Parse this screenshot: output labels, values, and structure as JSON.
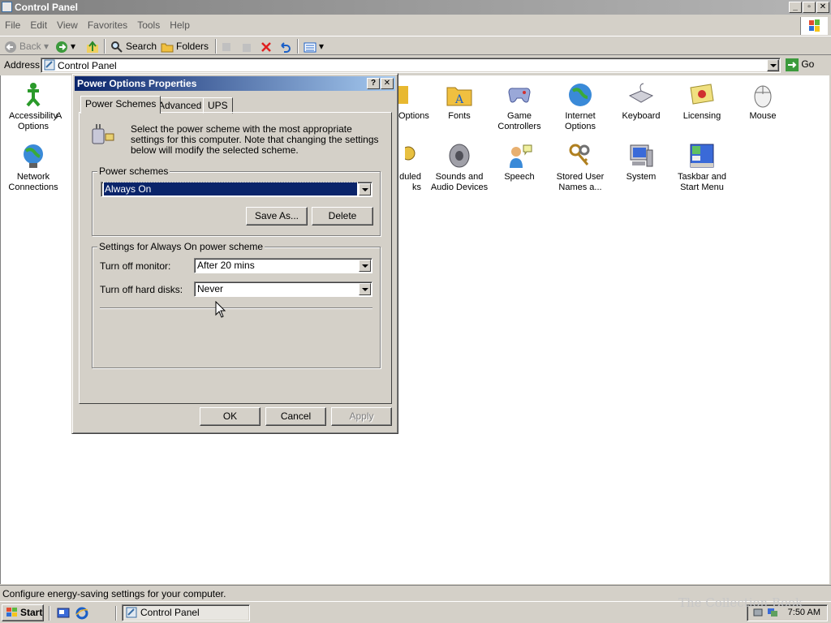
{
  "window": {
    "title": "Control Panel",
    "caption_buttons": [
      "_",
      "▫",
      "✕"
    ]
  },
  "menubar": {
    "items": [
      "File",
      "Edit",
      "View",
      "Favorites",
      "Tools",
      "Help"
    ]
  },
  "toolbar": {
    "back": "Back",
    "search": "Search",
    "folders": "Folders"
  },
  "address": {
    "label": "Address",
    "value": "Control Panel",
    "go": "Go"
  },
  "control_panel_items": [
    {
      "label": "Accessibility Options",
      "icon": "accessibility-icon"
    },
    {
      "label": "A",
      "icon": "add-hardware-icon"
    },
    {
      "label": "Options",
      "icon": "options-icon"
    },
    {
      "label": "Fonts",
      "icon": "fonts-folder-icon"
    },
    {
      "label": "Game Controllers",
      "icon": "game-controller-icon"
    },
    {
      "label": "Internet Options",
      "icon": "internet-globe-icon"
    },
    {
      "label": "Keyboard",
      "icon": "keyboard-icon"
    },
    {
      "label": "Licensing",
      "icon": "licensing-certificate-icon"
    },
    {
      "label": "Mouse",
      "icon": "mouse-icon"
    },
    {
      "label": "Network Connections",
      "icon": "network-globe-icon"
    },
    {
      "label": "duled\nks",
      "icon": "scheduled-tasks-icon"
    },
    {
      "label": "Sounds and Audio Devices",
      "icon": "speaker-icon"
    },
    {
      "label": "Speech",
      "icon": "speech-icon"
    },
    {
      "label": "Stored User Names a...",
      "icon": "keys-icon"
    },
    {
      "label": "System",
      "icon": "system-computer-icon"
    },
    {
      "label": "Taskbar and Start Menu",
      "icon": "taskbar-icon"
    }
  ],
  "dialog": {
    "title": "Power Options Properties",
    "help_btn": "?",
    "close_btn": "✕",
    "tabs": [
      "Power Schemes",
      "Advanced",
      "UPS"
    ],
    "description": "Select the power scheme with the most appropriate settings for this computer. Note that changing the settings below will modify the selected scheme.",
    "schemes_group": "Power schemes",
    "scheme_selected": "Always On",
    "save_as": "Save As...",
    "delete": "Delete",
    "settings_group": "Settings for Always On power scheme",
    "monitor_label": "Turn off monitor:",
    "monitor_value": "After 20 mins",
    "disks_label": "Turn off hard disks:",
    "disks_value": "Never",
    "ok": "OK",
    "cancel": "Cancel",
    "apply": "Apply"
  },
  "statusbar": {
    "text": "Configure energy-saving settings for your computer."
  },
  "taskbar": {
    "start": "Start",
    "task": "Control Panel",
    "clock": "7:50 AM",
    "watermark": "The Collection Book"
  }
}
